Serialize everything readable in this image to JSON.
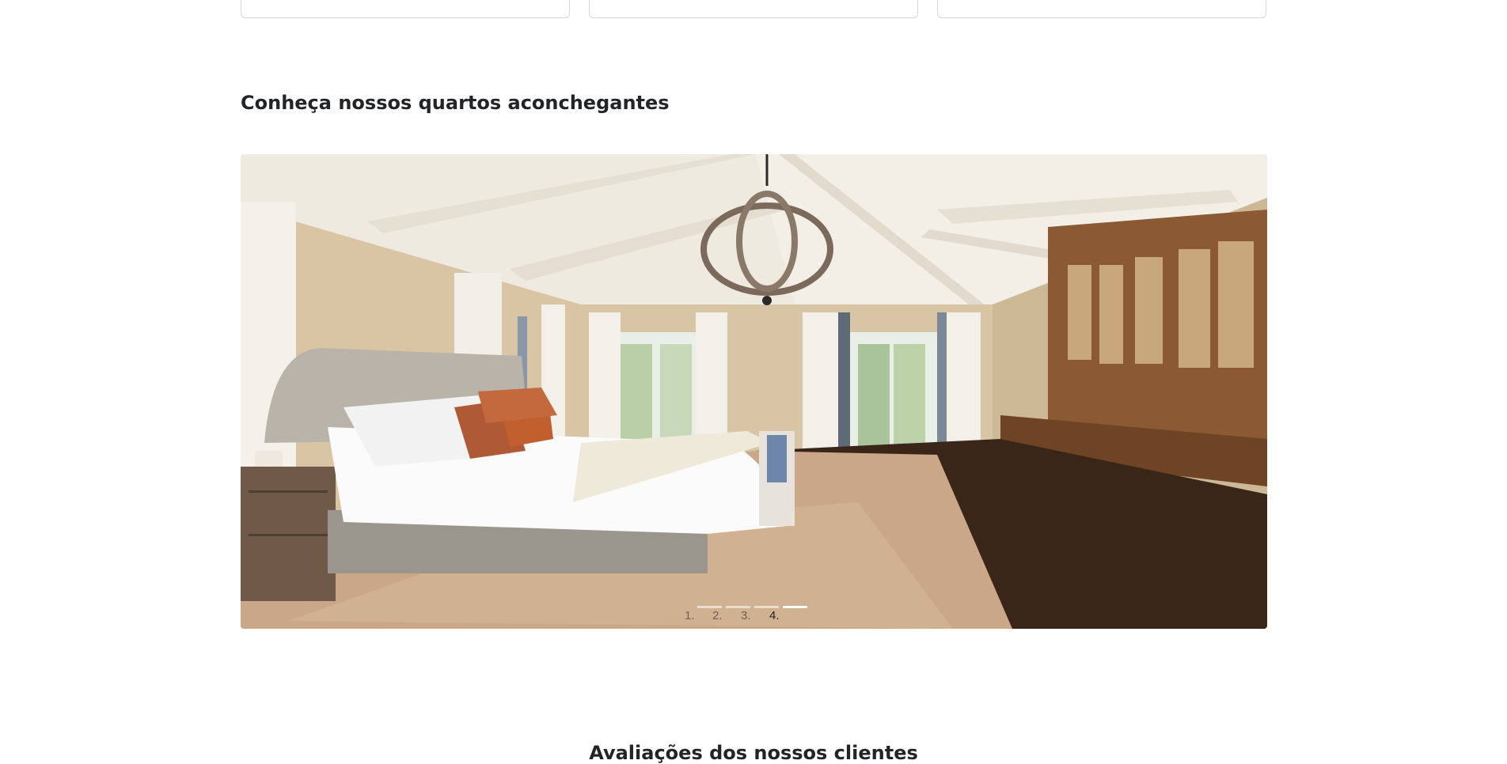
{
  "top_cards": [
    {
      "id": "card-1"
    },
    {
      "id": "card-2"
    },
    {
      "id": "card-3"
    }
  ],
  "rooms_section": {
    "title": "Conheça nossos quartos aconchegantes",
    "carousel": {
      "image": "bedroom-photo",
      "indicators": [
        {
          "label": "1.",
          "active": false
        },
        {
          "label": "2.",
          "active": false
        },
        {
          "label": "3.",
          "active": false
        },
        {
          "label": "4.",
          "active": true
        }
      ]
    }
  },
  "reviews_section": {
    "title": "Avaliações dos nossos clientes"
  }
}
